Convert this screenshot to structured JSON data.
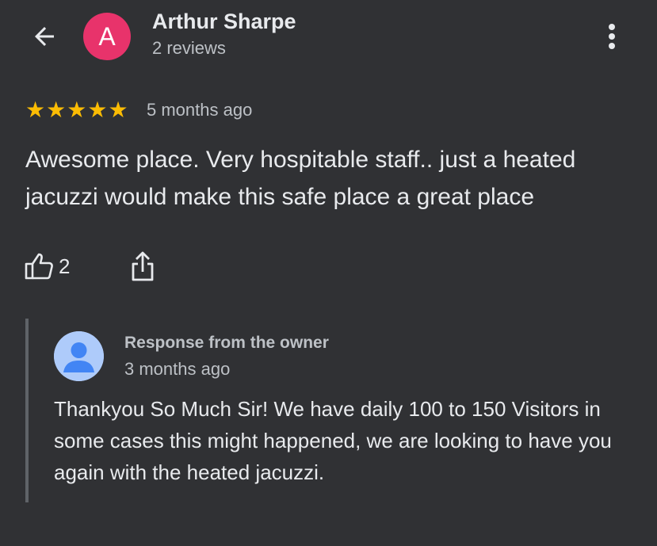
{
  "header": {
    "reviewer_name": "Arthur Sharpe",
    "reviewer_initial": "A",
    "review_count": "2 reviews",
    "back_icon": "arrow-left-icon",
    "more_icon": "more-vert-icon",
    "avatar_color": "#e8336b"
  },
  "review": {
    "rating": 5,
    "rating_max": 5,
    "time": "5 months ago",
    "text": "Awesome place. Very hospitable staff.. just a heated jacuzzi would make this safe place a great place",
    "star_color": "#fbbc04"
  },
  "actions": {
    "like_count": "2",
    "like_icon": "thumb-up-icon",
    "share_icon": "share-icon"
  },
  "owner_response": {
    "title": "Response from the owner",
    "time": "3 months ago",
    "text": "Thankyou So Much Sir! We have daily 100 to 150 Visitors in some cases this might happened, we are looking to have you again with the heated jacuzzi.",
    "avatar_icon": "person-avatar-icon",
    "avatar_color": "#aecbfa"
  },
  "colors": {
    "background": "#303134",
    "text_primary": "#e8eaed",
    "text_secondary": "#bdc1c6"
  }
}
